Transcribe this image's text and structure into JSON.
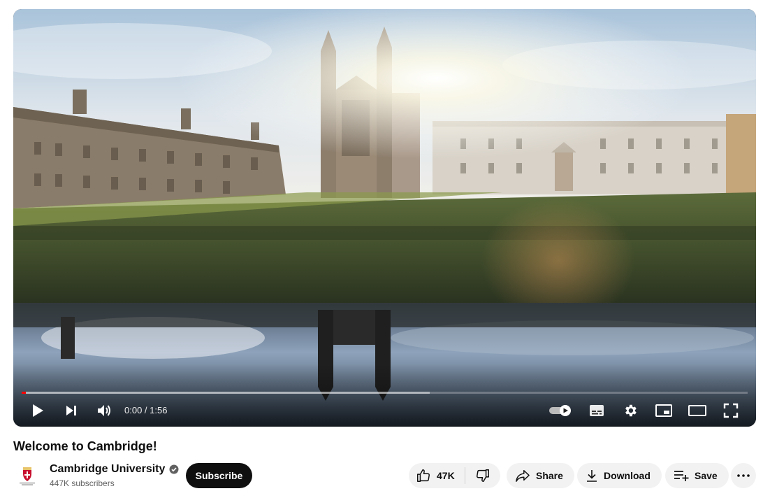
{
  "player": {
    "time_current": "0:00",
    "time_separator": " / ",
    "time_total": "1:56",
    "progress_played_fraction": 0.006,
    "progress_buffered_fraction": 0.562,
    "autoplay_on": true,
    "icons": [
      "play-icon",
      "next-icon",
      "volume-icon",
      "autoplay-toggle-icon",
      "subtitles-icon",
      "settings-icon",
      "miniplayer-icon",
      "theater-mode-icon",
      "fullscreen-icon"
    ],
    "accent_color": "#ff0000"
  },
  "video": {
    "title": "Welcome to Cambridge!"
  },
  "channel": {
    "name": "Cambridge University",
    "subscribers": "447K subscribers",
    "verified": true
  },
  "actions": {
    "subscribe_label": "Subscribe",
    "like_count": "47K",
    "share_label": "Share",
    "download_label": "Download",
    "save_label": "Save"
  }
}
